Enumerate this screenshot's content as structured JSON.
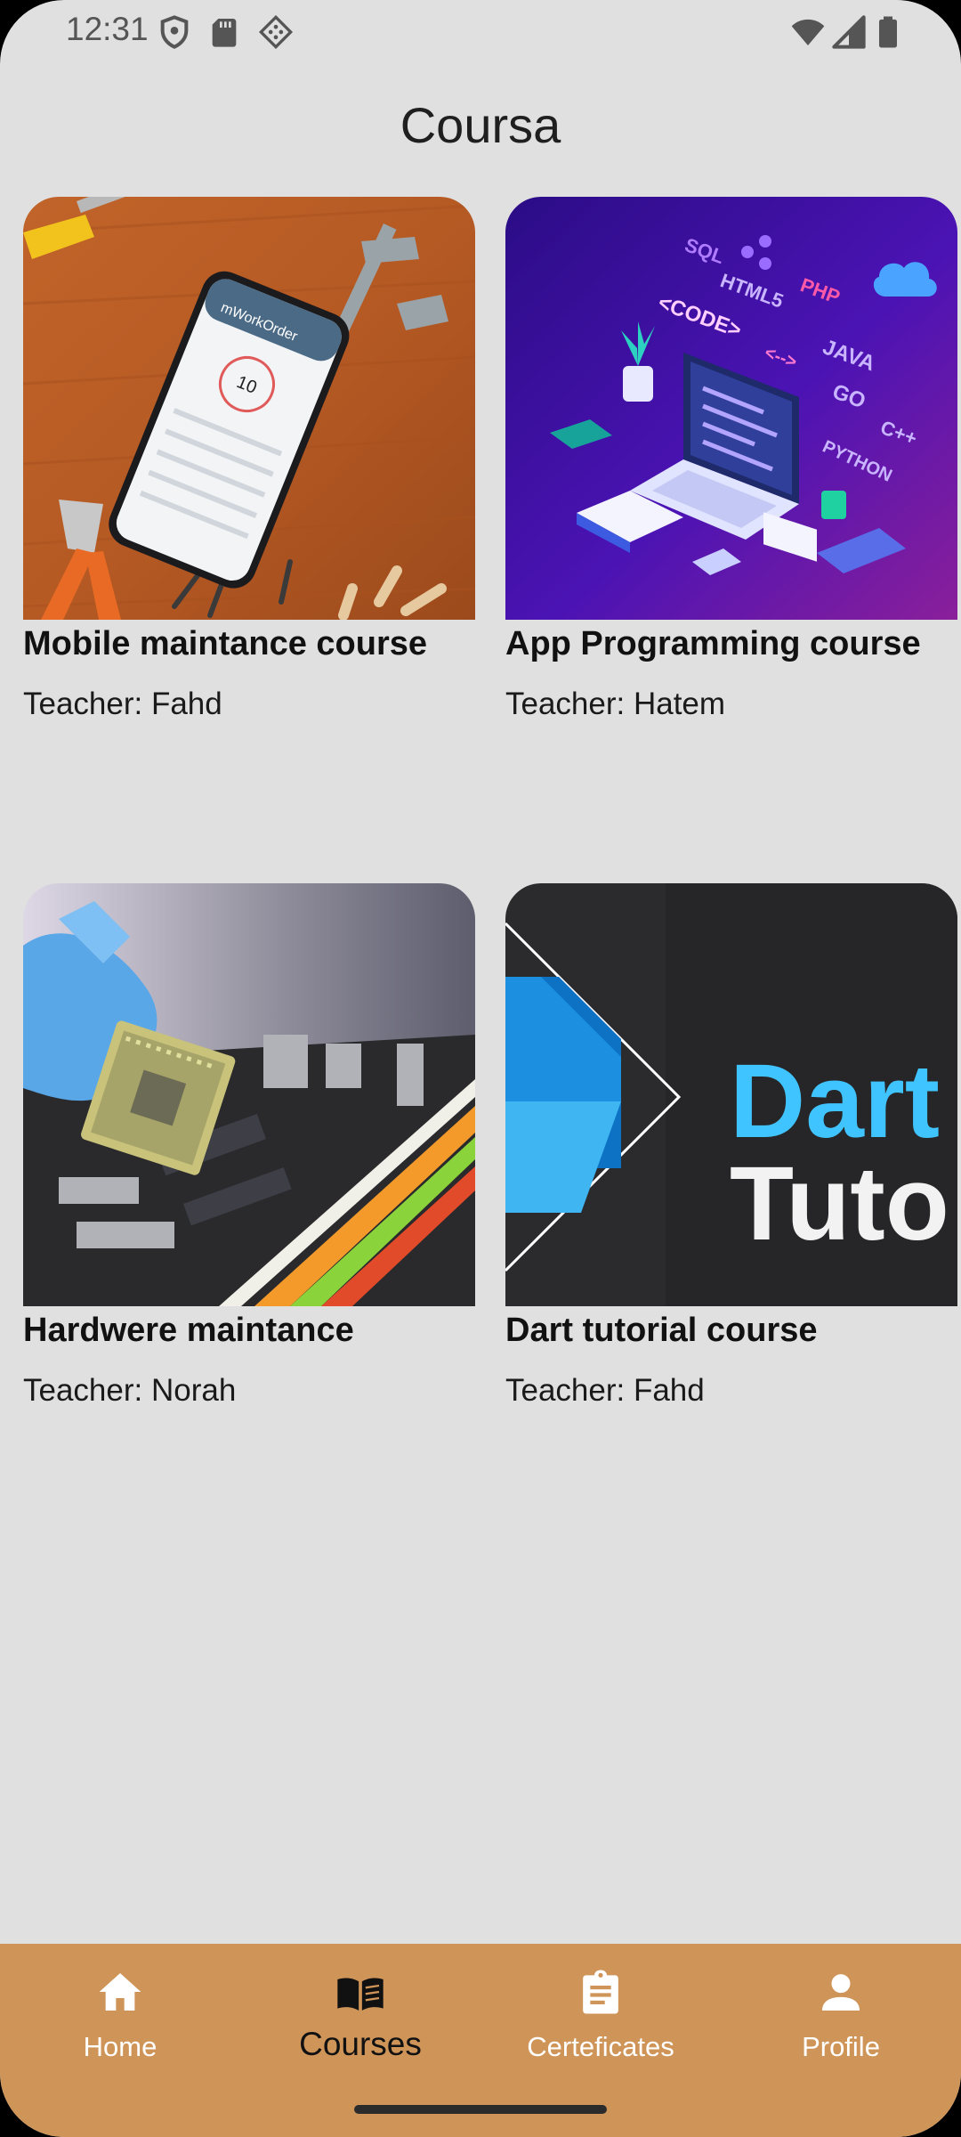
{
  "status_bar": {
    "time": "12:31",
    "left_icons": [
      "shield-icon",
      "sd-card-icon",
      "diamond-grid-icon"
    ],
    "right_icons": [
      "wifi-icon",
      "signal-icon",
      "battery-icon"
    ]
  },
  "header": {
    "title": "Coursa"
  },
  "courses": [
    {
      "title": "Mobile maintance course",
      "teacher": "Teacher: Fahd",
      "image_icon": "phone-on-wood-image",
      "phone_app_name": "mWorkOrder",
      "phone_number": "10"
    },
    {
      "title": "App Programming course",
      "teacher": "Teacher: Hatem",
      "image_icon": "isometric-laptop-image",
      "tech_words": [
        "SQL",
        "HTML5",
        "<CODE>",
        "PHP",
        "JAVA",
        "GO",
        "C++",
        "PYTHON",
        "<-->"
      ]
    },
    {
      "title": "Hardwere maintance",
      "teacher": "Teacher: Norah",
      "image_icon": "cpu-chip-image"
    },
    {
      "title": "Dart tutorial course",
      "teacher": "Teacher: Fahd",
      "image_icon": "dart-logo-image",
      "image_text_line1": "Dart",
      "image_text_line2": "Tuto"
    }
  ],
  "bottom_nav": {
    "items": [
      {
        "label": "Home",
        "icon": "home-icon",
        "active": false
      },
      {
        "label": "Courses",
        "icon": "book-icon",
        "active": true
      },
      {
        "label": "Certeficates",
        "icon": "clipboard-icon",
        "active": false
      },
      {
        "label": "Profile",
        "icon": "person-icon",
        "active": false
      }
    ]
  },
  "colors": {
    "background": "#e0e0e0",
    "nav_background": "#cf9458",
    "nav_active_text": "#111111",
    "nav_inactive_text": "#ffffff",
    "dart_blue": "#40c4ff"
  }
}
